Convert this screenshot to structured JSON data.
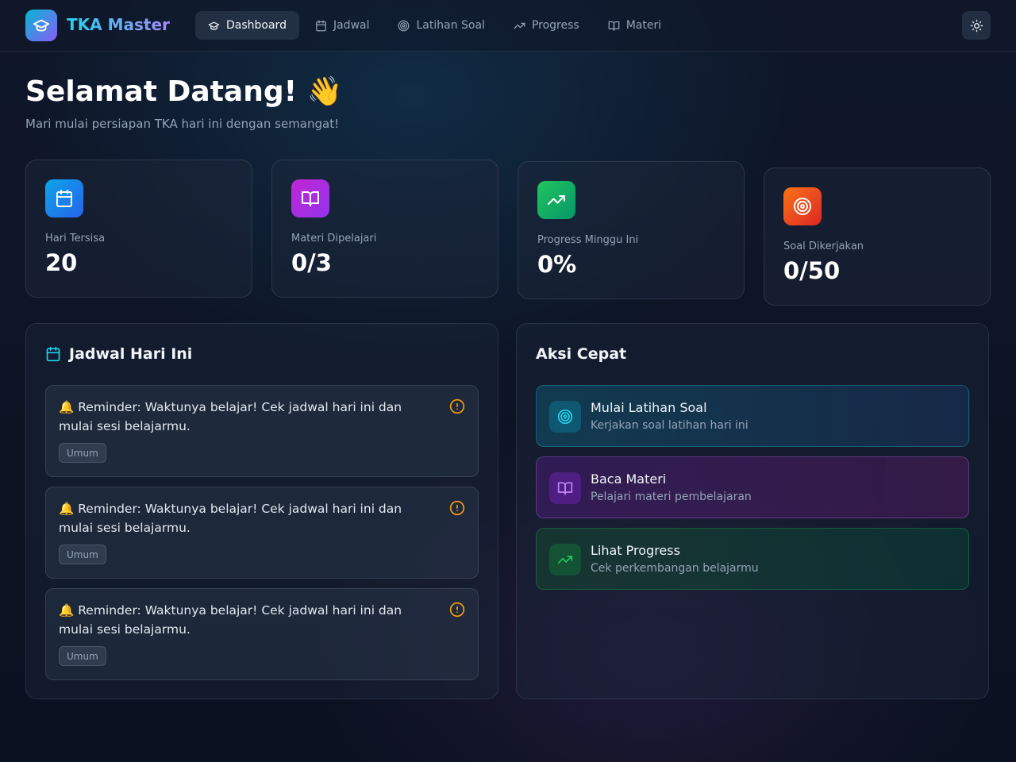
{
  "header": {
    "brand": "TKA Master",
    "nav": [
      {
        "label": "Dashboard",
        "icon": "graduation-cap-icon",
        "active": true
      },
      {
        "label": "Jadwal",
        "icon": "calendar-icon"
      },
      {
        "label": "Latihan Soal",
        "icon": "target-icon"
      },
      {
        "label": "Progress",
        "icon": "trending-up-icon"
      },
      {
        "label": "Materi",
        "icon": "book-open-icon"
      }
    ],
    "theme_icon": "sun-icon"
  },
  "hero": {
    "title": "Selamat Datang! 👋",
    "subtitle": "Mari mulai persiapan TKA hari ini dengan semangat!"
  },
  "stats": [
    {
      "label": "Hari Tersisa",
      "value": "20",
      "icon": "calendar-icon",
      "color": "#0ea5e9"
    },
    {
      "label": "Materi Dipelajari",
      "value": "0/3",
      "icon": "book-open-icon",
      "color": "#c026d3"
    },
    {
      "label": "Progress Minggu Ini",
      "value": "0%",
      "icon": "trending-up-icon",
      "color": "#16a34a"
    },
    {
      "label": "Soal Dikerjakan",
      "value": "0/50",
      "icon": "target-icon",
      "color": "#ea580c"
    }
  ],
  "schedule": {
    "title": "Jadwal Hari Ini",
    "items": [
      {
        "text": "🔔 Reminder: Waktunya belajar! Cek jadwal hari ini dan mulai sesi belajarmu.",
        "tag": "Umum"
      },
      {
        "text": "🔔 Reminder: Waktunya belajar! Cek jadwal hari ini dan mulai sesi belajarmu.",
        "tag": "Umum"
      },
      {
        "text": "🔔 Reminder: Waktunya belajar! Cek jadwal hari ini dan mulai sesi belajarmu.",
        "tag": "Umum"
      }
    ],
    "accent": "#f59e0b"
  },
  "quick_actions": {
    "title": "Aksi Cepat",
    "items": [
      {
        "title": "Mulai Latihan Soal",
        "subtitle": "Kerjakan soal latihan hari ini",
        "icon": "target-icon",
        "color": "#22d3ee"
      },
      {
        "title": "Baca Materi",
        "subtitle": "Pelajari materi pembelajaran",
        "icon": "book-open-icon",
        "color": "#c084fc"
      },
      {
        "title": "Lihat Progress",
        "subtitle": "Cek perkembangan belajarmu",
        "icon": "trending-up-icon",
        "color": "#22c55e"
      }
    ]
  }
}
